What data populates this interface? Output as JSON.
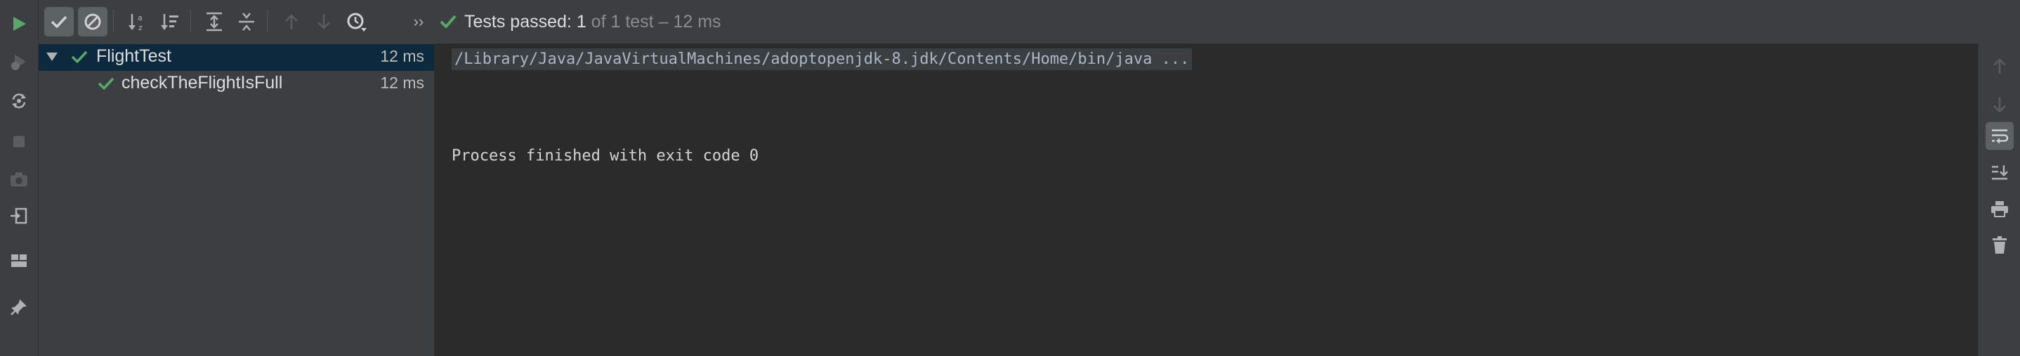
{
  "status": {
    "passed_label": "Tests passed:",
    "count": "1",
    "of_total": "of 1 test",
    "separator": "–",
    "duration": "12 ms"
  },
  "tree": {
    "root": {
      "name": "FlightTest",
      "time": "12 ms"
    },
    "children": [
      {
        "name": "checkTheFlightIsFull",
        "time": "12 ms"
      }
    ]
  },
  "console": {
    "command": "/Library/Java/JavaVirtualMachines/adoptopenjdk-8.jdk/Contents/Home/bin/java ...",
    "exit_message": "Process finished with exit code 0"
  },
  "toolbar": {
    "more_label": "››"
  },
  "colors": {
    "pass_green": "#59a869",
    "selection": "#0d293e",
    "panel": "#3c3f41",
    "console_bg": "#2b2b2b"
  },
  "icons": {
    "left_bar": [
      "rerun-icon",
      "rerun-failed-icon",
      "toggle-auto-test-icon",
      "stop-icon",
      "screenshot-icon",
      "import-tests-icon",
      "layout-icon",
      "pin-icon"
    ],
    "top_toolbar": [
      "show-passed-icon",
      "show-ignored-icon",
      "sort-alphabetically-icon",
      "sort-by-duration-icon",
      "expand-all-icon",
      "collapse-all-icon",
      "previous-failed-icon",
      "next-failed-icon",
      "test-history-icon",
      "more-icon"
    ],
    "right_bar": [
      "scroll-up-icon",
      "scroll-down-icon",
      "soft-wrap-icon",
      "scroll-to-end-icon",
      "print-icon",
      "clear-all-icon"
    ]
  }
}
